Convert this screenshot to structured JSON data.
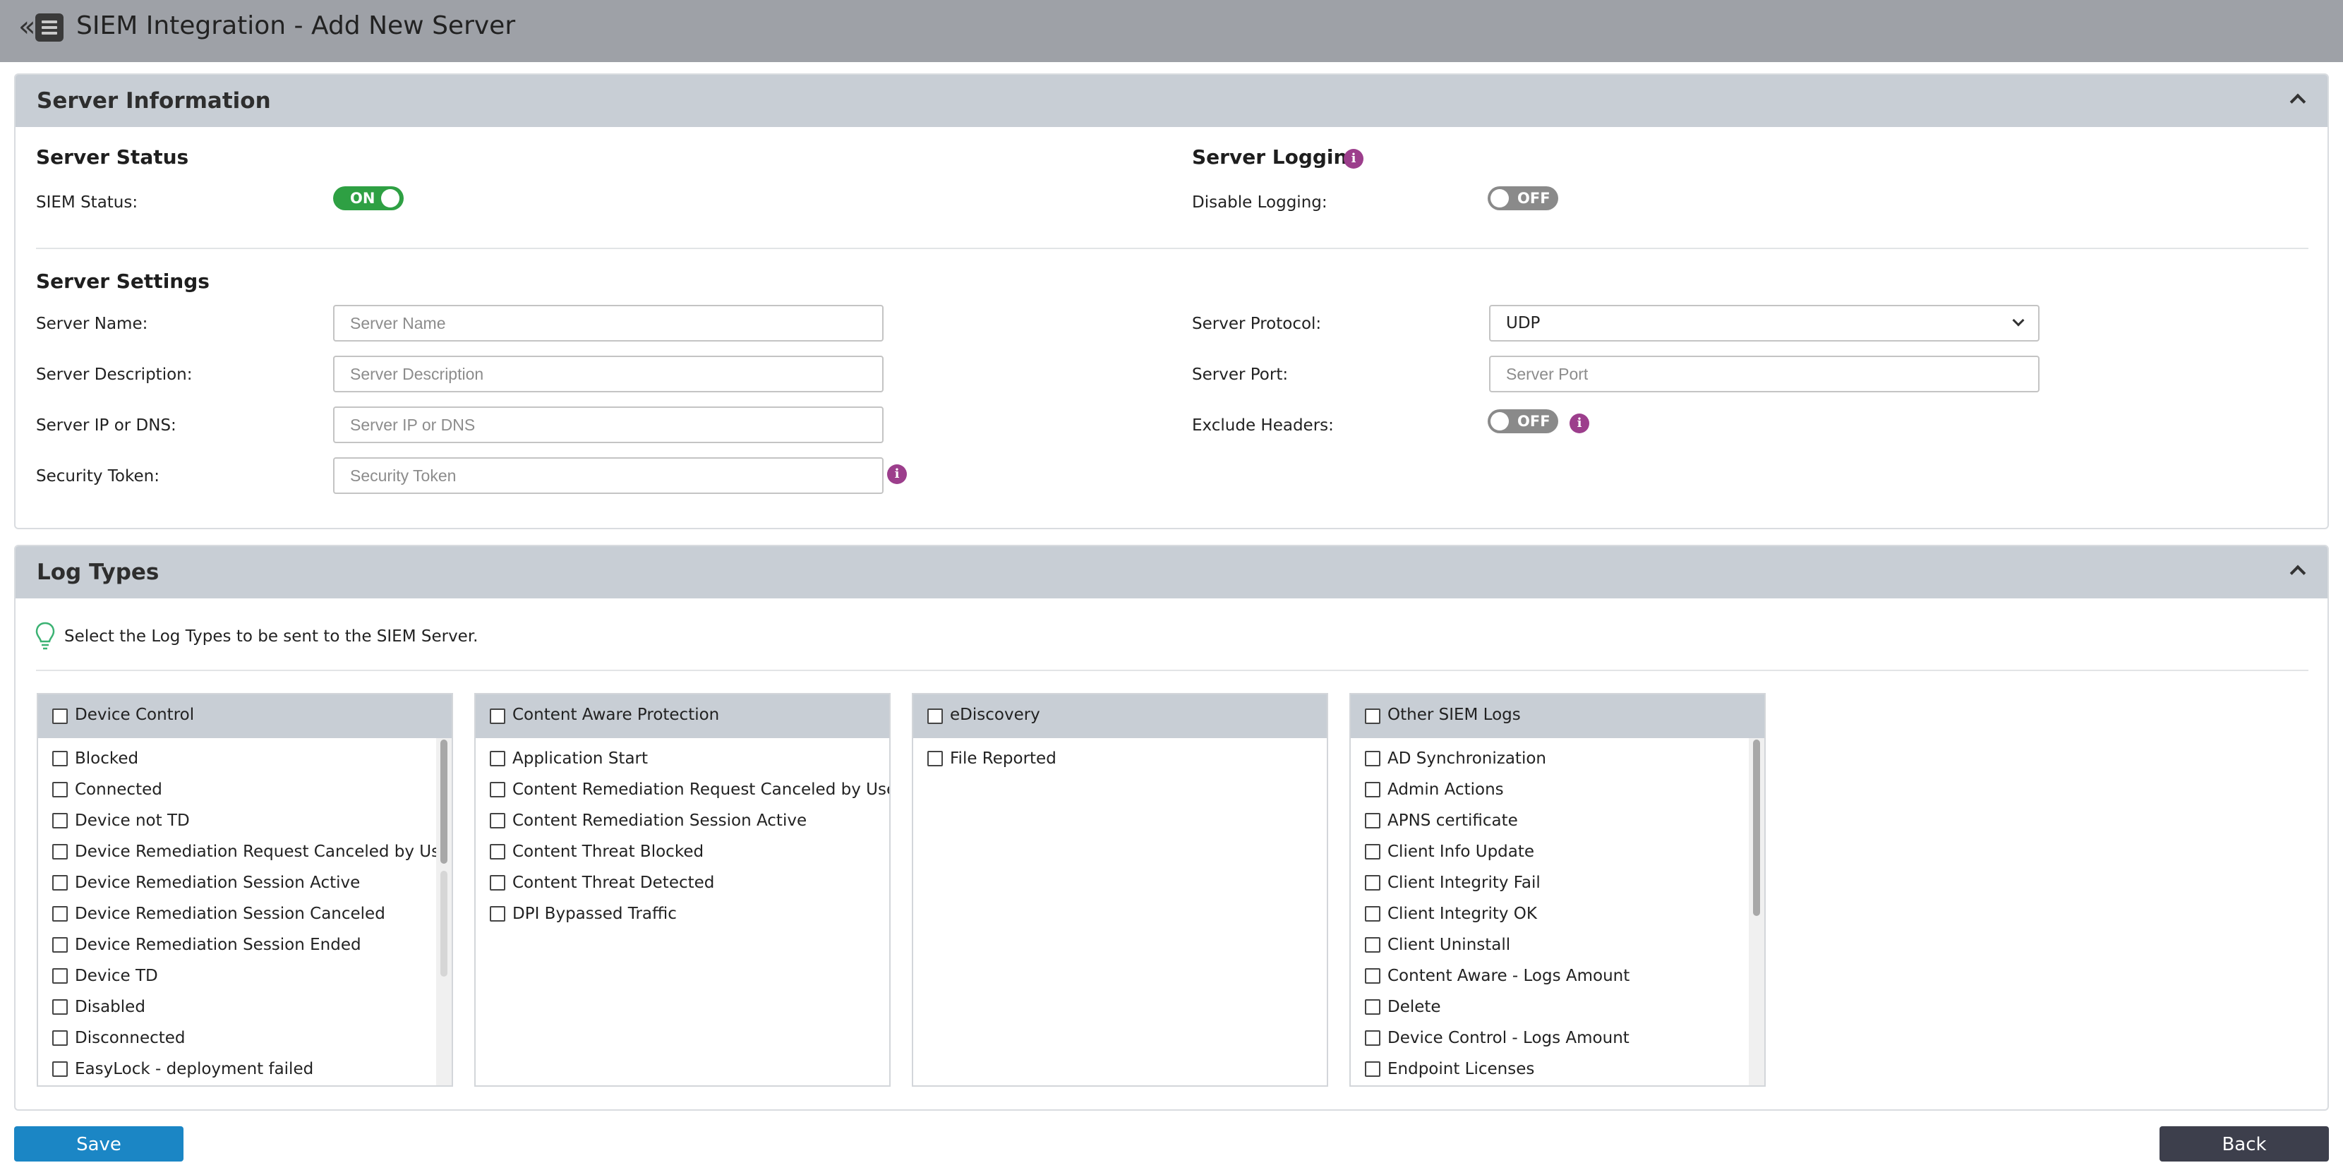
{
  "page": {
    "title": "SIEM Integration - Add New Server",
    "collapse_glyph": "«"
  },
  "server_information": {
    "title": "Server Information",
    "server_status": {
      "title": "Server Status",
      "siem_status_label": "SIEM Status:",
      "siem_status_value": "ON"
    },
    "server_logging": {
      "title": "Server Logging",
      "disable_logging_label": "Disable Logging:",
      "disable_logging_value": "OFF"
    },
    "server_settings": {
      "title": "Server Settings",
      "server_name": {
        "label": "Server Name:",
        "placeholder": "Server Name",
        "value": ""
      },
      "server_description": {
        "label": "Server Description:",
        "placeholder": "Server Description",
        "value": ""
      },
      "server_ip": {
        "label": "Server IP or DNS:",
        "placeholder": "Server IP or DNS",
        "value": ""
      },
      "security_token": {
        "label": "Security Token:",
        "placeholder": "Security Token",
        "value": ""
      },
      "server_protocol": {
        "label": "Server Protocol:",
        "value": "UDP"
      },
      "server_port": {
        "label": "Server Port:",
        "placeholder": "Server Port",
        "value": ""
      },
      "exclude_headers": {
        "label": "Exclude Headers:",
        "value": "OFF"
      }
    }
  },
  "log_types": {
    "title": "Log Types",
    "hint": "Select the Log Types to be sent to the SIEM Server.",
    "groups": [
      {
        "name": "Device Control",
        "items": [
          "Blocked",
          "Connected",
          "Device not TD",
          "Device Remediation Request Canceled by User",
          "Device Remediation Session Active",
          "Device Remediation Session Canceled",
          "Device Remediation Session Ended",
          "Device TD",
          "Disabled",
          "Disconnected",
          "EasyLock - deployment failed"
        ]
      },
      {
        "name": "Content Aware Protection",
        "items": [
          "Application Start",
          "Content Remediation Request Canceled by User",
          "Content Remediation Session Active",
          "Content Threat Blocked",
          "Content Threat Detected",
          "DPI Bypassed Traffic"
        ]
      },
      {
        "name": "eDiscovery",
        "items": [
          "File Reported"
        ]
      },
      {
        "name": "Other SIEM Logs",
        "items": [
          "AD Synchronization",
          "Admin Actions",
          "APNS certificate",
          "Client Info Update",
          "Client Integrity Fail",
          "Client Integrity OK",
          "Client Uninstall",
          "Content Aware - Logs Amount",
          "Delete",
          "Device Control - Logs Amount",
          "Endpoint Licenses"
        ]
      }
    ]
  },
  "actions": {
    "save_label": "Save",
    "back_label": "Back"
  },
  "icons": {
    "info": "info-icon",
    "bulb": "lightbulb-icon",
    "menu": "menu-icon"
  },
  "colors": {
    "toggle_on": "#2ea043",
    "toggle_off": "#8a8a8a",
    "save": "#1b86c5",
    "back": "#3d3f4c",
    "info": "#9c3e8c"
  }
}
